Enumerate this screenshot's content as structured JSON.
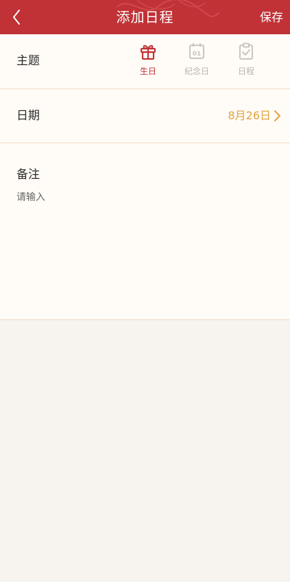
{
  "header": {
    "title": "添加日程",
    "save_label": "保存",
    "background_color": "#c03236"
  },
  "topic": {
    "label": "主题",
    "options": [
      {
        "label": "生日",
        "icon": "gift-icon",
        "selected": true
      },
      {
        "label": "纪念日",
        "icon": "calendar-01-icon",
        "selected": false
      },
      {
        "label": "日程",
        "icon": "checklist-icon",
        "selected": false
      }
    ],
    "active_color": "#c03236",
    "inactive_color": "#b9b4ad"
  },
  "date": {
    "label": "日期",
    "value": "8月26日",
    "value_color": "#e0a33c"
  },
  "note": {
    "label": "备注",
    "placeholder": "请输入",
    "value": ""
  }
}
